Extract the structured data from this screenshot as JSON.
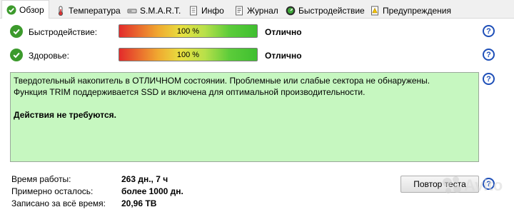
{
  "tabs": [
    {
      "label": "Обзор",
      "icon": "check-circle-icon",
      "active": true
    },
    {
      "label": "Температура",
      "icon": "thermometer-icon",
      "active": false
    },
    {
      "label": "S.M.A.R.T.",
      "icon": "drive-icon",
      "active": false
    },
    {
      "label": "Инфо",
      "icon": "document-icon",
      "active": false
    },
    {
      "label": "Журнал",
      "icon": "journal-icon",
      "active": false
    },
    {
      "label": "Быстродействие",
      "icon": "speedometer-icon",
      "active": false
    },
    {
      "label": "Предупреждения",
      "icon": "warning-document-icon",
      "active": false
    }
  ],
  "metrics": [
    {
      "label": "Быстродействие:",
      "percent_text": "100 %",
      "value_fraction": 1.0,
      "status": "Отлично"
    },
    {
      "label": "Здоровье:",
      "percent_text": "100 %",
      "value_fraction": 1.0,
      "status": "Отлично"
    }
  ],
  "message": {
    "line1": "Твердотельный накопитель в ОТЛИЧНОМ состоянии. Проблемные или слабые сектора не обнаружены.",
    "line2": "Функция TRIM поддерживается SSD и включена для оптимальной производительности.",
    "action": "Действия не требуются."
  },
  "info": [
    {
      "label": "Время работы:",
      "value": "263 дн., 7 ч"
    },
    {
      "label": "Примерно осталось:",
      "value": "более 1000 дн."
    },
    {
      "label": "Записано за всё время:",
      "value": "20,96 TB"
    }
  ],
  "retest_button": "Повтор теста",
  "help_symbol": "?",
  "watermark": "Avito",
  "colors": {
    "message_bg": "#c6f7c0",
    "check": "#3c9a2c",
    "help": "#1e4fb8"
  }
}
